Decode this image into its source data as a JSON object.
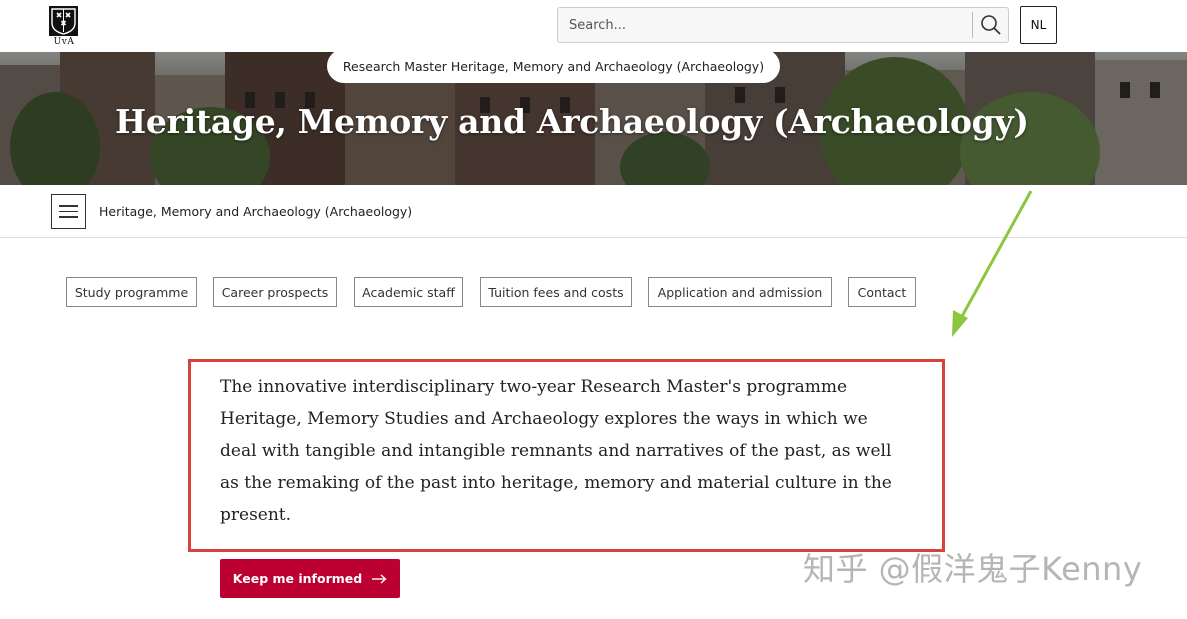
{
  "header": {
    "logo_text": "UvA",
    "search_placeholder": "Search...",
    "lang_button": "NL"
  },
  "hero": {
    "breadcrumb_pill": "Research Master Heritage, Memory and Archaeology (Archaeology)",
    "title": "Heritage, Memory and Archaeology (Archaeology)"
  },
  "subnav": {
    "title": "Heritage, Memory and Archaeology (Archaeology)"
  },
  "tabs": [
    {
      "label": "Study programme"
    },
    {
      "label": "Career prospects"
    },
    {
      "label": "Academic staff"
    },
    {
      "label": "Tuition fees and costs"
    },
    {
      "label": "Application and admission"
    },
    {
      "label": "Contact"
    }
  ],
  "intro": {
    "text": "The innovative interdisciplinary two-year Research Master's programme Heritage, Memory Studies and Archaeology explores the ways in which we deal with tangible and intangible remnants and narratives of the past, as well as the remaking of the past into heritage, memory and material culture in the present."
  },
  "cta": {
    "label": "Keep me informed",
    "color": "#bc0031"
  },
  "annotation": {
    "highlight_color": "#d9423a",
    "arrow_color": "#8cc63f",
    "watermark": "知乎 @假洋鬼子Kenny"
  }
}
